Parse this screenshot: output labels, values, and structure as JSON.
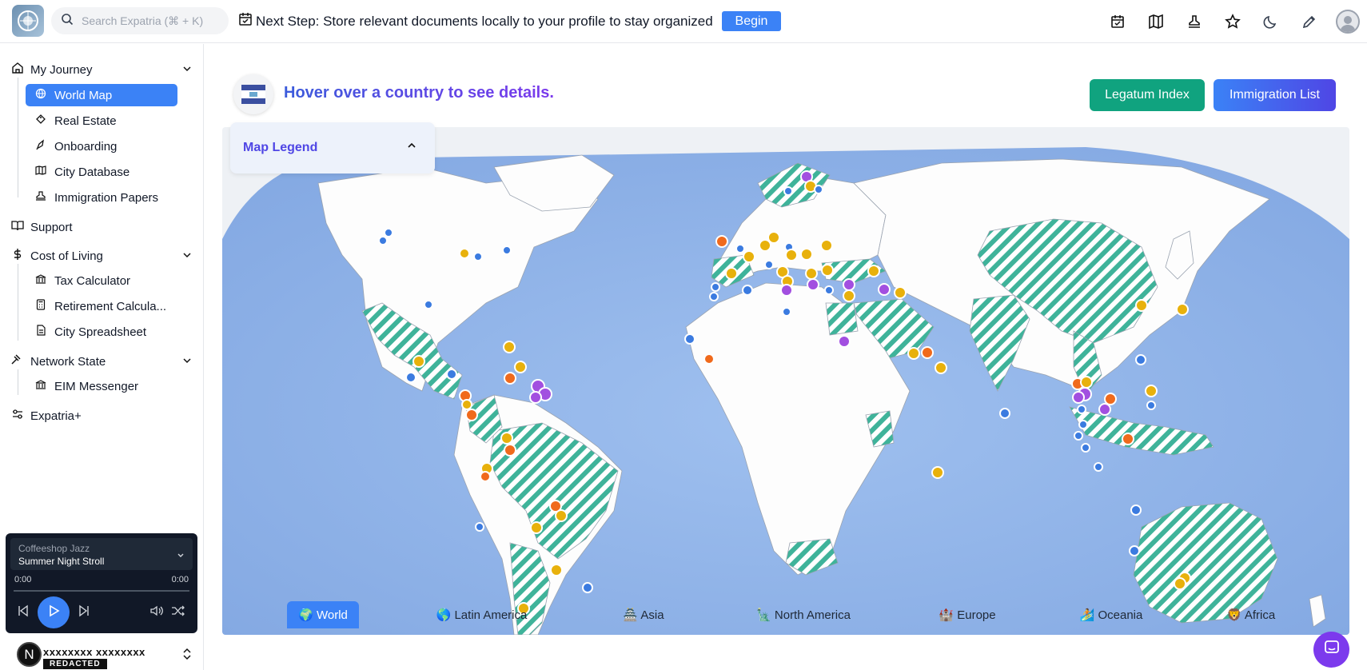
{
  "header": {
    "search_placeholder": "Search Expatria (⌘ + K)",
    "next_step_text": "Next Step: Store relevant documents locally to your profile to stay organized",
    "begin_label": "Begin"
  },
  "sidebar": {
    "sections": [
      {
        "label": "My Journey",
        "icon": "home-icon",
        "expandable": true,
        "items": [
          {
            "label": "World Map",
            "icon": "globe-icon",
            "active": true
          },
          {
            "label": "Real Estate",
            "icon": "tag-icon"
          },
          {
            "label": "Onboarding",
            "icon": "rocket-icon"
          },
          {
            "label": "City Database",
            "icon": "map-icon"
          },
          {
            "label": "Immigration Papers",
            "icon": "stamp-icon"
          }
        ]
      },
      {
        "label": "Support",
        "icon": "book-icon"
      },
      {
        "label": "Cost of Living",
        "icon": "dollar-icon",
        "expandable": true,
        "items": [
          {
            "label": "Tax Calculator",
            "icon": "bank-icon"
          },
          {
            "label": "Retirement Calcula...",
            "icon": "calculator-icon"
          },
          {
            "label": "City Spreadsheet",
            "icon": "sheet-icon"
          }
        ]
      },
      {
        "label": "Network State",
        "icon": "gavel-icon",
        "expandable": true,
        "items": [
          {
            "label": "EIM Messenger",
            "icon": "bank-icon"
          }
        ]
      },
      {
        "label": "Expatria+",
        "icon": "sliders-icon"
      }
    ]
  },
  "player": {
    "playlist": "Coffeeshop Jazz",
    "song": "Summer Night Stroll",
    "time_current": "0:00",
    "time_total": "0:00"
  },
  "profile": {
    "initial": "N",
    "name": "xxxxxxxx xxxxxxxx",
    "badge": "REDACTED"
  },
  "main": {
    "hover_title": "Hover over a country to see details.",
    "legatum_label": "Legatum Index",
    "immigration_label": "Immigration List",
    "legend_label": "Map Legend"
  },
  "tabs": [
    {
      "label": "🌍 World",
      "active": true
    },
    {
      "label": "🌎 Latin America"
    },
    {
      "label": "🏯 Asia"
    },
    {
      "label": "🗽 North America"
    },
    {
      "label": "🏰 Europe"
    },
    {
      "label": "🏄 Oceania"
    },
    {
      "label": "🦁 Africa"
    }
  ],
  "colors": {
    "accent": "#3b82f6",
    "legatum": "#10a37f",
    "ocean": "#8fb2e6",
    "hatch": "#3fb39a",
    "marker_blue": "#3b7be0",
    "marker_yellow": "#e8b10c",
    "marker_orange": "#f06a1c",
    "marker_purple": "#a24fe0"
  }
}
